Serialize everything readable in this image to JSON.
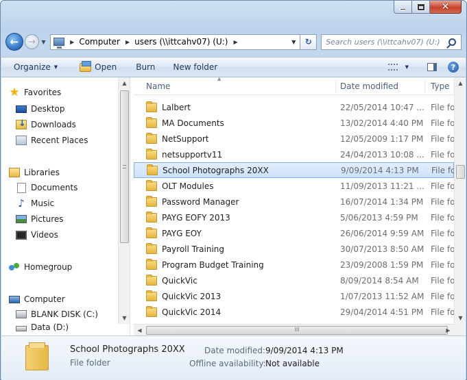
{
  "window": {
    "caption_minimize": "—",
    "caption_maximize": "□",
    "caption_close": "x"
  },
  "address_bar": {
    "crumbs": [
      "Computer",
      "users (\\\\ittcahv07) (U:)"
    ],
    "search_placeholder": "Search users (\\\\ittcahv07) (U:)"
  },
  "command_bar": {
    "organize": "Organize",
    "open": "Open",
    "burn": "Burn",
    "new_folder": "New folder"
  },
  "nav_pane": {
    "favorites": "Favorites",
    "desktop": "Desktop",
    "downloads": "Downloads",
    "recent_places": "Recent Places",
    "libraries": "Libraries",
    "documents": "Documents",
    "music": "Music",
    "pictures": "Pictures",
    "videos": "Videos",
    "homegroup": "Homegroup",
    "computer": "Computer",
    "blank_disk": "BLANK DISK (C:)",
    "data_drive": "Data (D:)"
  },
  "file_list": {
    "columns": {
      "name": "Name",
      "date_modified": "Date modified",
      "type": "Type"
    },
    "rows": [
      {
        "name": "Lalbert",
        "date": "22/05/2014 10:47 ...",
        "type": "File folder",
        "selected": false
      },
      {
        "name": "MA Documents",
        "date": "13/02/2014 4:40 PM",
        "type": "File folder",
        "selected": false
      },
      {
        "name": "NetSupport",
        "date": "12/05/2009 1:17 PM",
        "type": "File folder",
        "selected": false
      },
      {
        "name": "netsupportv11",
        "date": "24/04/2013 10:08 ...",
        "type": "File folder",
        "selected": false
      },
      {
        "name": "School Photographs 20XX",
        "date": "9/09/2014 4:13 PM",
        "type": "File folder",
        "selected": true
      },
      {
        "name": "OLT Modules",
        "date": "11/09/2013 11:21 ...",
        "type": "File folder",
        "selected": false
      },
      {
        "name": "Password Manager",
        "date": "16/07/2014 1:34 PM",
        "type": "File folder",
        "selected": false
      },
      {
        "name": "PAYG EOFY 2013",
        "date": "5/06/2013 4:59 PM",
        "type": "File folder",
        "selected": false
      },
      {
        "name": "PAYG EOY",
        "date": "26/06/2014 9:59 AM",
        "type": "File folder",
        "selected": false
      },
      {
        "name": "Payroll Training",
        "date": "30/07/2013 8:50 AM",
        "type": "File folder",
        "selected": false
      },
      {
        "name": "Program Budget Training",
        "date": "23/09/2008 1:59 PM",
        "type": "File folder",
        "selected": false
      },
      {
        "name": "QuickVic",
        "date": "8/09/2014 8:54 AM",
        "type": "File folder",
        "selected": false
      },
      {
        "name": "QuickVic 2013",
        "date": "1/07/2013 11:52 AM",
        "type": "File folder",
        "selected": false
      },
      {
        "name": "QuickVic 2014",
        "date": "29/04/2014 4:51 PM",
        "type": "File folder",
        "selected": false
      }
    ],
    "hscroll_grip": "III"
  },
  "details": {
    "name": "School Photographs 20XX",
    "type": "File folder",
    "date_label": "Date modified:",
    "date_value": "9/09/2014 4:13 PM",
    "offline_label": "Offline availability:",
    "offline_value": "Not available"
  }
}
